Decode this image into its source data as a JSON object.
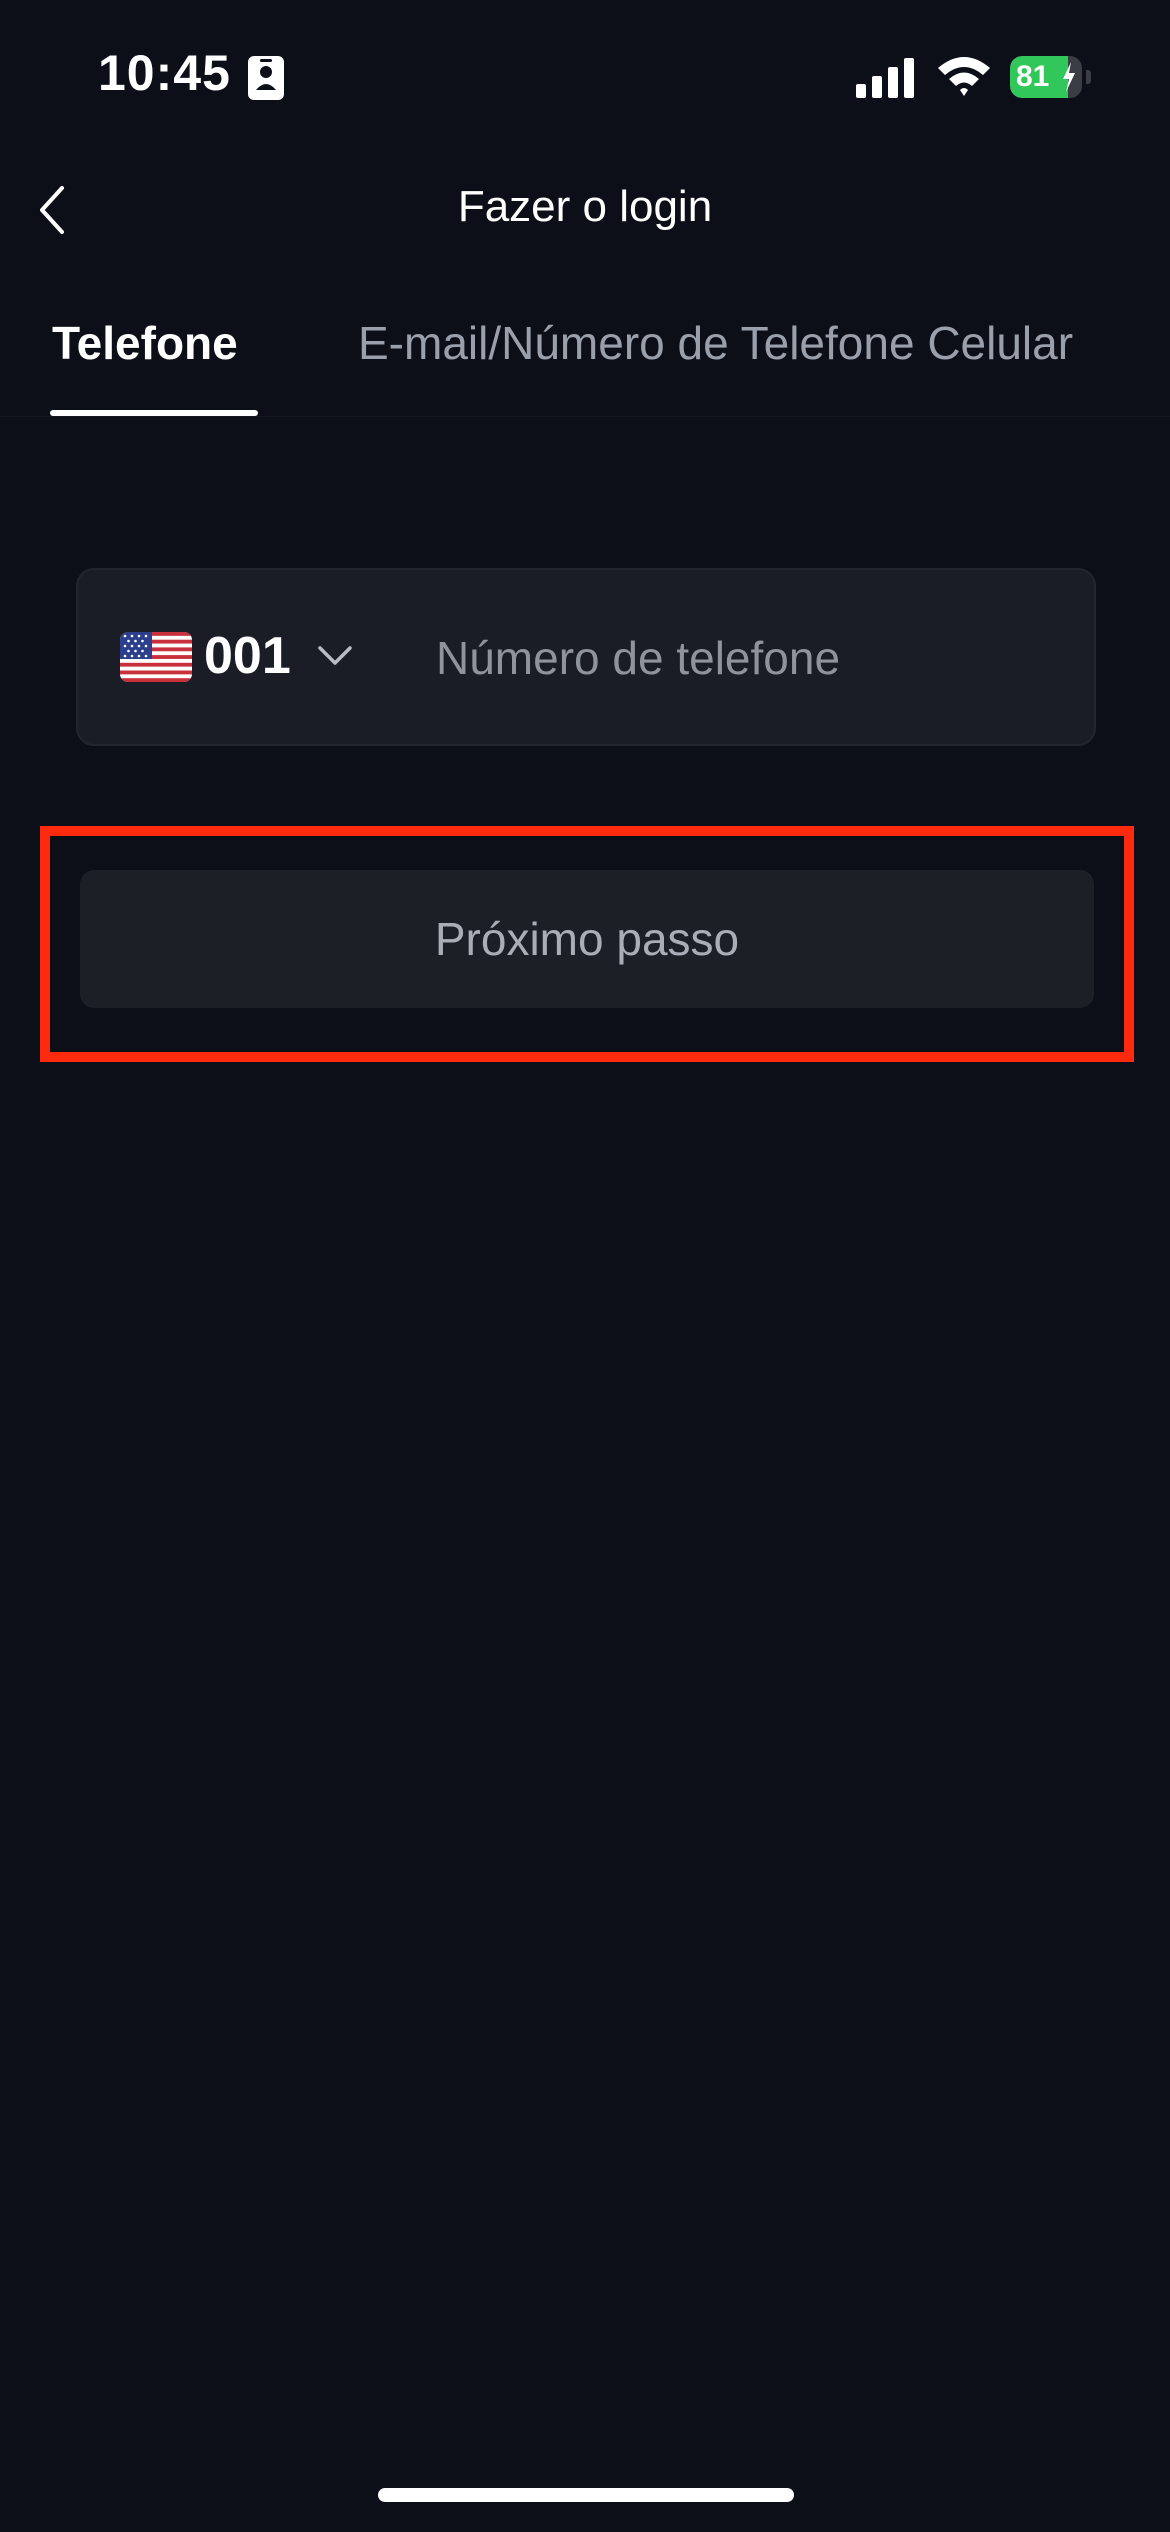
{
  "status_bar": {
    "time": "10:45",
    "battery_level": "81",
    "battery_charging": true,
    "icons": [
      "id-badge-icon",
      "cellular-signal-icon",
      "wifi-icon",
      "battery-charging-icon"
    ]
  },
  "nav": {
    "title": "Fazer o login",
    "back_icon": "chevron-left-icon"
  },
  "tabs": [
    {
      "label": "Telefone",
      "active": true
    },
    {
      "label": "E-mail/Número de Telefone Celular",
      "active": false
    }
  ],
  "phone_form": {
    "country_flag": "us-flag-icon",
    "country_code": "001",
    "input_value": "",
    "input_placeholder": "Número de telefone"
  },
  "next_button": {
    "label": "Próximo passo",
    "highlight_color": "#ff2a0e"
  },
  "colors": {
    "background": "#0c0f18",
    "field_background": "#1a1d26",
    "battery_green": "#31c75a",
    "inactive_text": "#9aa0ab"
  }
}
